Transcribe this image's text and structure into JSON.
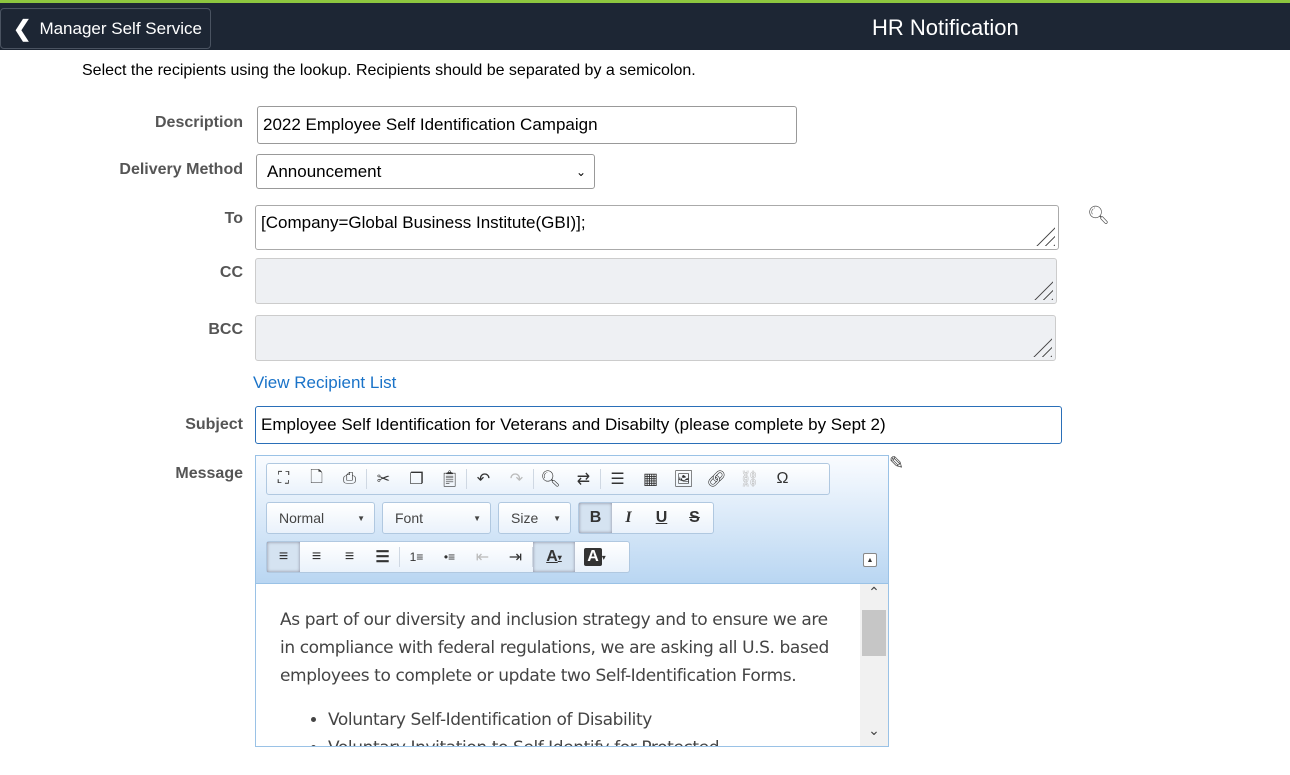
{
  "header": {
    "back_label": "Manager Self Service",
    "title": "HR Notification"
  },
  "instructions": "Select the recipients using the lookup. Recipients should be separated by a semicolon.",
  "form": {
    "description_label": "Description",
    "description_value": "2022 Employee Self Identification Campaign",
    "delivery_label": "Delivery Method",
    "delivery_value": "Announcement",
    "to_label": "To",
    "to_value": "[Company=Global Business Institute(GBI)];",
    "cc_label": "CC",
    "cc_value": "",
    "bcc_label": "BCC",
    "bcc_value": "",
    "view_recipient_link": "View Recipient List",
    "subject_label": "Subject",
    "subject_value": "Employee Self Identification for Veterans and Disabilty (please complete by Sept 2)",
    "message_label": "Message"
  },
  "editor": {
    "format_combo": "Normal",
    "font_combo": "Font",
    "size_combo": "Size",
    "paragraph": "As part of our diversity and inclusion strategy and to ensure we are in compliance with federal regulations, we are asking all U.S. based employees to complete or update two Self-Identification Forms.",
    "bullets": [
      "Voluntary Self-Identification of Disability",
      "Voluntary Invitation to Self-Identify for Protected"
    ]
  }
}
